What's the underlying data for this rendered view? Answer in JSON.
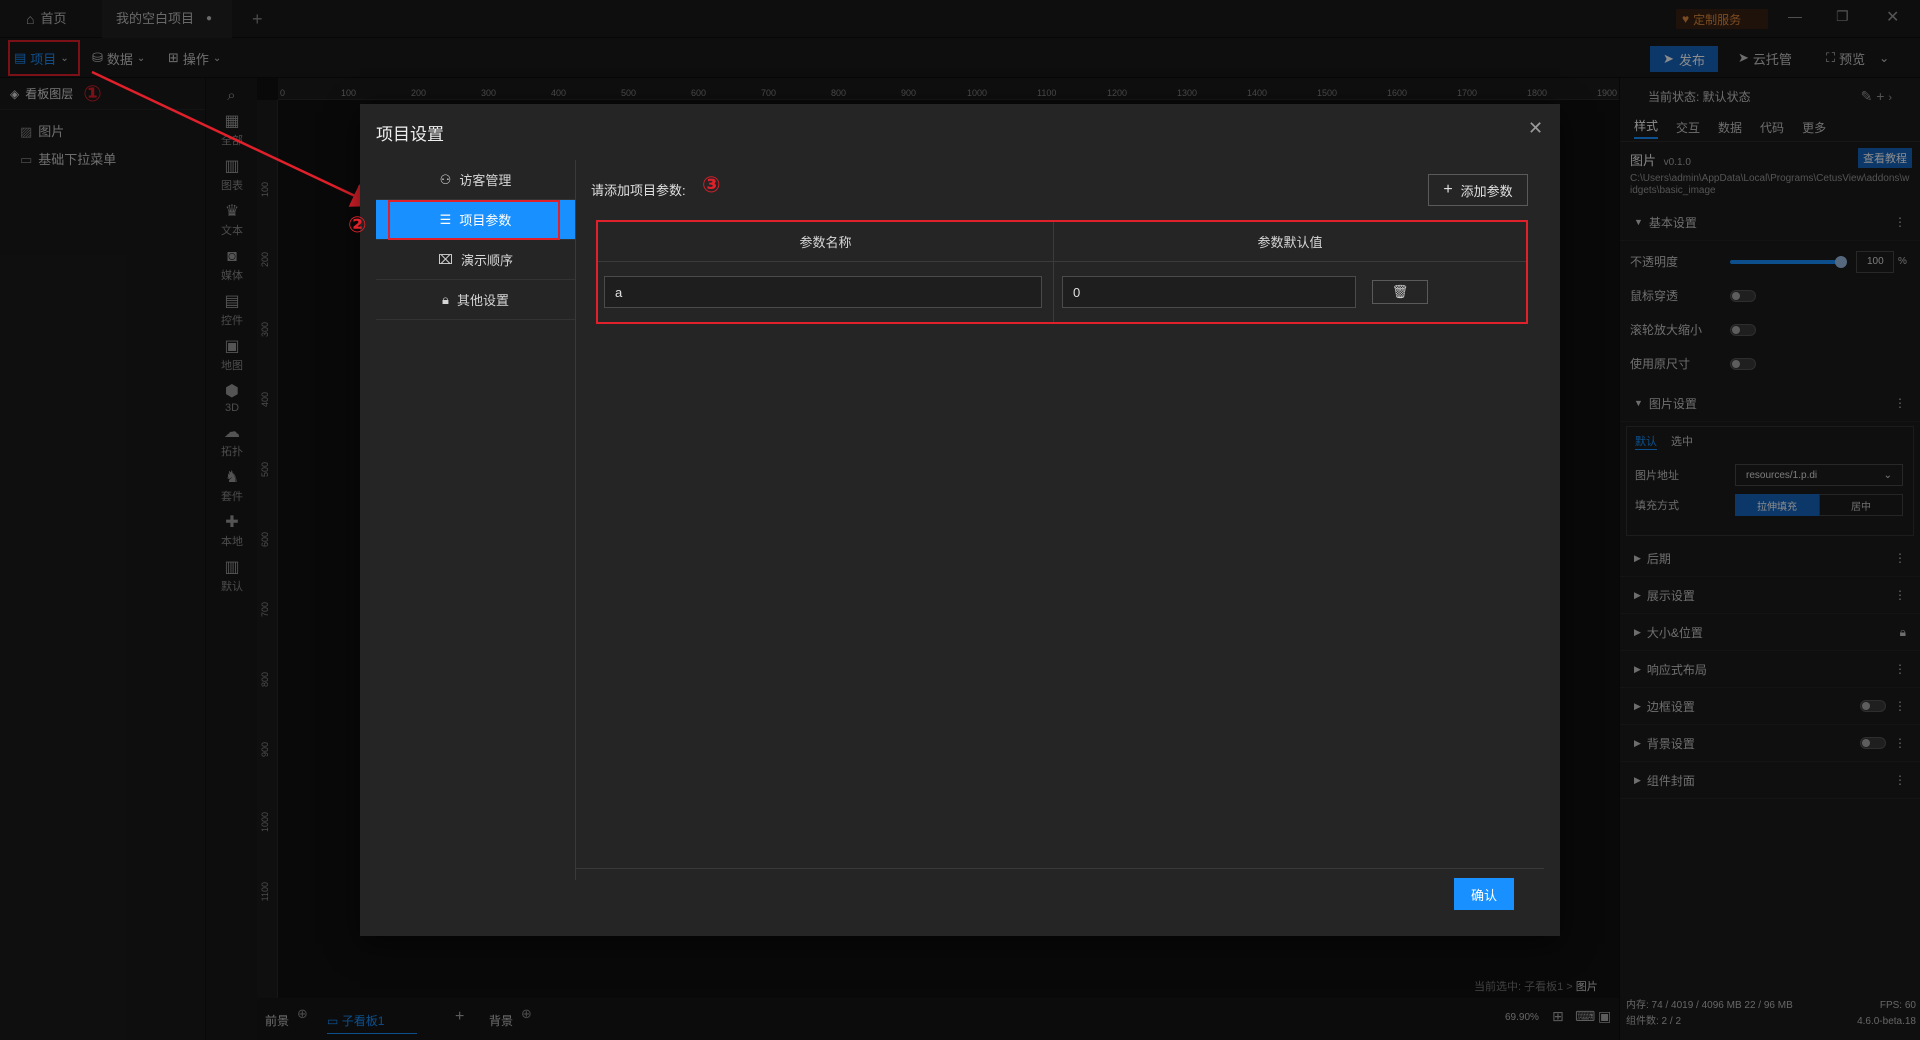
{
  "tabs": {
    "home": "首页",
    "project": "我的空白项目",
    "add": "+"
  },
  "window": {
    "custom_service": "定制服务"
  },
  "menubar": {
    "project": "项目",
    "data": "数据",
    "ops": "操作",
    "publish": "发布",
    "cloud": "云托管",
    "preview": "预览"
  },
  "left": {
    "header": "看板图层",
    "layers": [
      "图片",
      "基础下拉菜单"
    ]
  },
  "iconbar": [
    {
      "label": "全部",
      "icon": "grid"
    },
    {
      "label": "图表",
      "icon": "chart"
    },
    {
      "label": "文本",
      "icon": "text"
    },
    {
      "label": "媒体",
      "icon": "media"
    },
    {
      "label": "控件",
      "icon": "control"
    },
    {
      "label": "地图",
      "icon": "map"
    },
    {
      "label": "3D",
      "icon": "cube"
    },
    {
      "label": "拓扑",
      "icon": "topo"
    },
    {
      "label": "套件",
      "icon": "kit"
    },
    {
      "label": "本地",
      "icon": "puzzle"
    },
    {
      "label": "默认",
      "icon": "chart2"
    }
  ],
  "ruler": {
    "top": [
      "0",
      "100",
      "200",
      "300",
      "400",
      "500",
      "600",
      "700",
      "800",
      "900",
      "1000",
      "1100",
      "1200",
      "1300",
      "1400",
      "1500",
      "1600",
      "1700",
      "1800",
      "1900"
    ],
    "left": [
      "100",
      "200",
      "300",
      "400",
      "500",
      "600",
      "700",
      "800",
      "900",
      "1000",
      "1100"
    ]
  },
  "right": {
    "state_label": "当前状态: 默认状态",
    "tabs": [
      "样式",
      "交互",
      "数据",
      "代码",
      "更多"
    ],
    "widget_name": "图片",
    "widget_version": "v0.1.0",
    "tutorial": "查看教程",
    "widget_path": "C:\\Users\\admin\\AppData\\Local\\Programs\\CetusView\\addons\\widgets\\basic_image",
    "basic": "基本设置",
    "opacity_label": "不透明度",
    "opacity_value": "100",
    "opacity_unit": "%",
    "opacity_fraction": 1.0,
    "mouse_through": "鼠标穿透",
    "wheel_zoom": "滚轮放大缩小",
    "original_size": "使用原尺寸",
    "image_settings": "图片设置",
    "sub_tabs": [
      "默认",
      "选中"
    ],
    "image_url_label": "图片地址",
    "image_url": "resources/1.p.di",
    "fill_label": "填充方式",
    "fill_options": [
      "拉伸填充",
      "居中"
    ],
    "sections": [
      "后期",
      "展示设置",
      "大小&位置",
      "响应式布局",
      "边框设置",
      "背景设置",
      "组件封面"
    ]
  },
  "bottom": {
    "front": "前景",
    "subboard": "子看板1",
    "back": "背景",
    "zoom": "69.90%",
    "selected": "当前选中: 子看板1 > ",
    "selected_item": "图片"
  },
  "status": {
    "memory": "内存: 74 / 4019 / 4096 MB  22 / 96 MB",
    "components": "组件数: 2 / 2",
    "fps": "FPS: 60",
    "version": "4.6.0-beta.18"
  },
  "dialog": {
    "title": "项目设置",
    "nav": [
      "访客管理",
      "项目参数",
      "演示顺序",
      "其他设置"
    ],
    "hint": "请添加项目参数:",
    "add_param": "添加参数",
    "col_name": "参数名称",
    "col_default": "参数默认值",
    "rows": [
      {
        "name": "a",
        "default": "0"
      }
    ],
    "confirm": "确认"
  },
  "annotations": [
    "①",
    "②",
    "③"
  ]
}
